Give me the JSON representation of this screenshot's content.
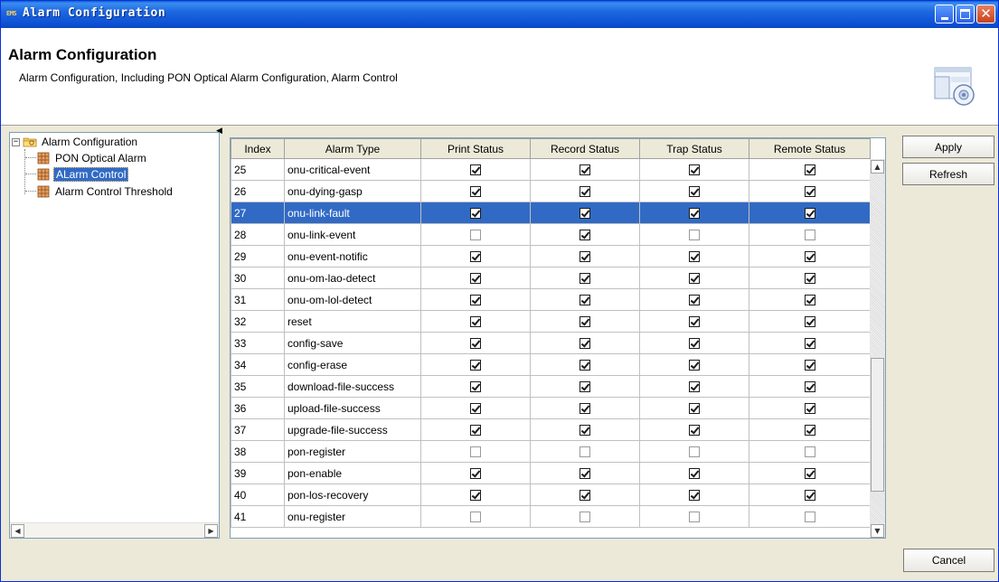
{
  "window": {
    "title": "Alarm Configuration",
    "app_icon_text": "EMS"
  },
  "header": {
    "title": "Alarm Configuration",
    "description": "Alarm Configuration, Including PON Optical Alarm Configuration, Alarm Control"
  },
  "tree": {
    "root": "Alarm Configuration",
    "items": [
      {
        "label": "PON Optical Alarm",
        "selected": false
      },
      {
        "label": "ALarm Control",
        "selected": true
      },
      {
        "label": "Alarm Control Threshold",
        "selected": false
      }
    ]
  },
  "table": {
    "columns": [
      "Index",
      "Alarm Type",
      "Print Status",
      "Record Status",
      "Trap Status",
      "Remote Status"
    ],
    "rows": [
      {
        "index": "25",
        "type": "onu-critical-event",
        "print": true,
        "record": true,
        "trap": true,
        "remote": true
      },
      {
        "index": "26",
        "type": "onu-dying-gasp",
        "print": true,
        "record": true,
        "trap": true,
        "remote": true
      },
      {
        "index": "27",
        "type": "onu-link-fault",
        "print": true,
        "record": true,
        "trap": true,
        "remote": true,
        "selected": true
      },
      {
        "index": "28",
        "type": "onu-link-event",
        "print": false,
        "record": true,
        "trap": false,
        "remote": false
      },
      {
        "index": "29",
        "type": "onu-event-notific",
        "print": true,
        "record": true,
        "trap": true,
        "remote": true
      },
      {
        "index": "30",
        "type": "onu-om-lao-detect",
        "print": true,
        "record": true,
        "trap": true,
        "remote": true
      },
      {
        "index": "31",
        "type": "onu-om-lol-detect",
        "print": true,
        "record": true,
        "trap": true,
        "remote": true
      },
      {
        "index": "32",
        "type": "reset",
        "print": true,
        "record": true,
        "trap": true,
        "remote": true
      },
      {
        "index": "33",
        "type": "config-save",
        "print": true,
        "record": true,
        "trap": true,
        "remote": true
      },
      {
        "index": "34",
        "type": "config-erase",
        "print": true,
        "record": true,
        "trap": true,
        "remote": true
      },
      {
        "index": "35",
        "type": "download-file-success",
        "print": true,
        "record": true,
        "trap": true,
        "remote": true
      },
      {
        "index": "36",
        "type": "upload-file-success",
        "print": true,
        "record": true,
        "trap": true,
        "remote": true
      },
      {
        "index": "37",
        "type": "upgrade-file-success",
        "print": true,
        "record": true,
        "trap": true,
        "remote": true
      },
      {
        "index": "38",
        "type": "pon-register",
        "print": false,
        "record": false,
        "trap": false,
        "remote": false
      },
      {
        "index": "39",
        "type": "pon-enable",
        "print": true,
        "record": true,
        "trap": true,
        "remote": true
      },
      {
        "index": "40",
        "type": "pon-los-recovery",
        "print": true,
        "record": true,
        "trap": true,
        "remote": true
      },
      {
        "index": "41",
        "type": "onu-register",
        "print": false,
        "record": false,
        "trap": false,
        "remote": false
      }
    ]
  },
  "buttons": {
    "apply": "Apply",
    "refresh": "Refresh",
    "cancel": "Cancel"
  },
  "colors": {
    "titlebar": "#0c4fd2",
    "selection": "#316ac5",
    "window_bg": "#ece9d8"
  }
}
